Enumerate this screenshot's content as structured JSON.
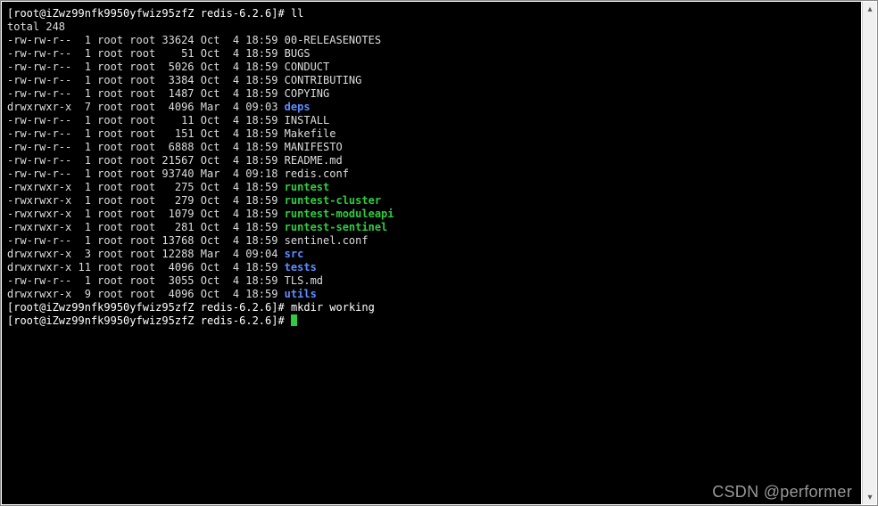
{
  "prompt": {
    "open": "[",
    "user_host": "root@iZwz99nfk9950yfwiz95zfZ",
    "path": "redis-6.2.6",
    "close": "]#"
  },
  "lines": {
    "cmd_ll": "ll",
    "total": "total 248",
    "cmd_mkdir": "mkdir working",
    "cmd_empty": ""
  },
  "listing": [
    {
      "perm": "-rw-rw-r--",
      "lnk": " 1",
      "own": "root",
      "grp": "root",
      "size": "33624",
      "mon": "Oct",
      "day": " 4",
      "time": "18:59",
      "name": "00-RELEASENOTES",
      "class": "plain"
    },
    {
      "perm": "-rw-rw-r--",
      "lnk": " 1",
      "own": "root",
      "grp": "root",
      "size": "   51",
      "mon": "Oct",
      "day": " 4",
      "time": "18:59",
      "name": "BUGS",
      "class": "plain"
    },
    {
      "perm": "-rw-rw-r--",
      "lnk": " 1",
      "own": "root",
      "grp": "root",
      "size": " 5026",
      "mon": "Oct",
      "day": " 4",
      "time": "18:59",
      "name": "CONDUCT",
      "class": "plain"
    },
    {
      "perm": "-rw-rw-r--",
      "lnk": " 1",
      "own": "root",
      "grp": "root",
      "size": " 3384",
      "mon": "Oct",
      "day": " 4",
      "time": "18:59",
      "name": "CONTRIBUTING",
      "class": "plain"
    },
    {
      "perm": "-rw-rw-r--",
      "lnk": " 1",
      "own": "root",
      "grp": "root",
      "size": " 1487",
      "mon": "Oct",
      "day": " 4",
      "time": "18:59",
      "name": "COPYING",
      "class": "plain"
    },
    {
      "perm": "drwxrwxr-x",
      "lnk": " 7",
      "own": "root",
      "grp": "root",
      "size": " 4096",
      "mon": "Mar",
      "day": " 4",
      "time": "09:03",
      "name": "deps",
      "class": "dir"
    },
    {
      "perm": "-rw-rw-r--",
      "lnk": " 1",
      "own": "root",
      "grp": "root",
      "size": "   11",
      "mon": "Oct",
      "day": " 4",
      "time": "18:59",
      "name": "INSTALL",
      "class": "plain"
    },
    {
      "perm": "-rw-rw-r--",
      "lnk": " 1",
      "own": "root",
      "grp": "root",
      "size": "  151",
      "mon": "Oct",
      "day": " 4",
      "time": "18:59",
      "name": "Makefile",
      "class": "plain"
    },
    {
      "perm": "-rw-rw-r--",
      "lnk": " 1",
      "own": "root",
      "grp": "root",
      "size": " 6888",
      "mon": "Oct",
      "day": " 4",
      "time": "18:59",
      "name": "MANIFESTO",
      "class": "plain"
    },
    {
      "perm": "-rw-rw-r--",
      "lnk": " 1",
      "own": "root",
      "grp": "root",
      "size": "21567",
      "mon": "Oct",
      "day": " 4",
      "time": "18:59",
      "name": "README.md",
      "class": "plain"
    },
    {
      "perm": "-rw-rw-r--",
      "lnk": " 1",
      "own": "root",
      "grp": "root",
      "size": "93740",
      "mon": "Mar",
      "day": " 4",
      "time": "09:18",
      "name": "redis.conf",
      "class": "plain"
    },
    {
      "perm": "-rwxrwxr-x",
      "lnk": " 1",
      "own": "root",
      "grp": "root",
      "size": "  275",
      "mon": "Oct",
      "day": " 4",
      "time": "18:59",
      "name": "runtest",
      "class": "exe"
    },
    {
      "perm": "-rwxrwxr-x",
      "lnk": " 1",
      "own": "root",
      "grp": "root",
      "size": "  279",
      "mon": "Oct",
      "day": " 4",
      "time": "18:59",
      "name": "runtest-cluster",
      "class": "exe"
    },
    {
      "perm": "-rwxrwxr-x",
      "lnk": " 1",
      "own": "root",
      "grp": "root",
      "size": " 1079",
      "mon": "Oct",
      "day": " 4",
      "time": "18:59",
      "name": "runtest-moduleapi",
      "class": "exe"
    },
    {
      "perm": "-rwxrwxr-x",
      "lnk": " 1",
      "own": "root",
      "grp": "root",
      "size": "  281",
      "mon": "Oct",
      "day": " 4",
      "time": "18:59",
      "name": "runtest-sentinel",
      "class": "exe"
    },
    {
      "perm": "-rw-rw-r--",
      "lnk": " 1",
      "own": "root",
      "grp": "root",
      "size": "13768",
      "mon": "Oct",
      "day": " 4",
      "time": "18:59",
      "name": "sentinel.conf",
      "class": "plain"
    },
    {
      "perm": "drwxrwxr-x",
      "lnk": " 3",
      "own": "root",
      "grp": "root",
      "size": "12288",
      "mon": "Mar",
      "day": " 4",
      "time": "09:04",
      "name": "src",
      "class": "dir"
    },
    {
      "perm": "drwxrwxr-x",
      "lnk": "11",
      "own": "root",
      "grp": "root",
      "size": " 4096",
      "mon": "Oct",
      "day": " 4",
      "time": "18:59",
      "name": "tests",
      "class": "dir"
    },
    {
      "perm": "-rw-rw-r--",
      "lnk": " 1",
      "own": "root",
      "grp": "root",
      "size": " 3055",
      "mon": "Oct",
      "day": " 4",
      "time": "18:59",
      "name": "TLS.md",
      "class": "plain"
    },
    {
      "perm": "drwxrwxr-x",
      "lnk": " 9",
      "own": "root",
      "grp": "root",
      "size": " 4096",
      "mon": "Oct",
      "day": " 4",
      "time": "18:59",
      "name": "utils",
      "class": "dir"
    }
  ],
  "watermark": "CSDN @performer"
}
